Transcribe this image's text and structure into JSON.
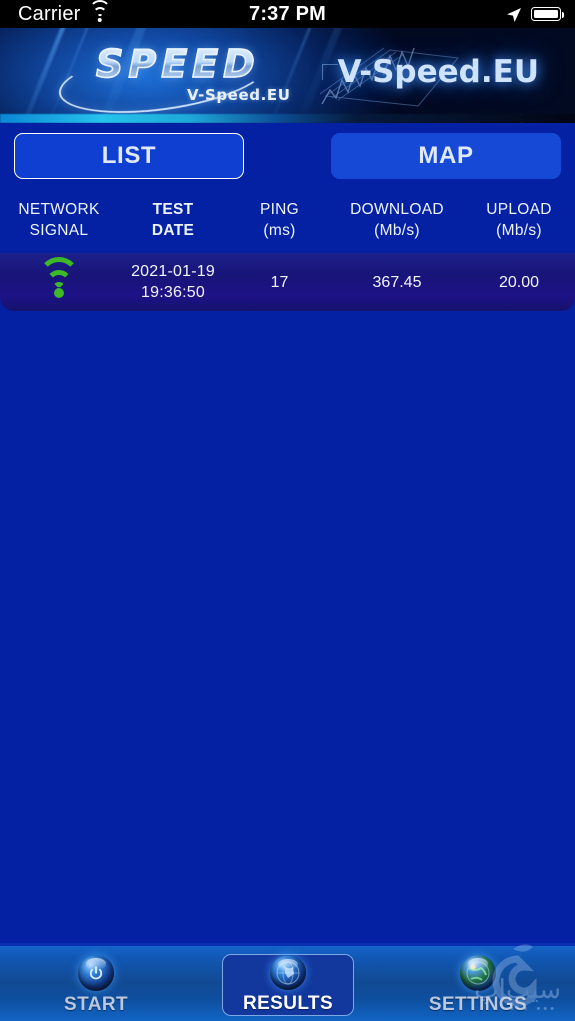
{
  "statusbar": {
    "carrier": "Carrier",
    "wifi_icon": "wifi-icon",
    "time": "7:37 PM",
    "location_icon": "location-arrow-icon",
    "battery_icon": "battery-full-icon"
  },
  "banner": {
    "logo_word": "SPEED",
    "logo_subtitle": "V-Speed.EU",
    "title": "V-Speed.EU",
    "map_art": "network-graph-art"
  },
  "segments": {
    "list_label": "LIST",
    "map_label": "MAP",
    "selected": "LIST"
  },
  "table": {
    "columns": [
      {
        "line1": "NETWORK",
        "line2": "SIGNAL",
        "bold": false
      },
      {
        "line1": "TEST",
        "line2": "DATE",
        "bold": true
      },
      {
        "line1": "PING",
        "line2": "(ms)",
        "bold": false
      },
      {
        "line1": "DOWNLOAD",
        "line2": "(Mb/s)",
        "bold": false
      },
      {
        "line1": "UPLOAD",
        "line2": "(Mb/s)",
        "bold": false
      }
    ],
    "rows": [
      {
        "signal_icon": "wifi-icon",
        "date": "2021-01-19",
        "time": "19:36:50",
        "ping": "17",
        "download": "367.45",
        "upload": "20.00"
      }
    ]
  },
  "tabbar": {
    "start_label": "START",
    "start_icon": "power-icon",
    "results_label": "RESULTS",
    "results_icon": "globe-icon",
    "settings_label": "SETTINGS",
    "settings_icon": "globe-gear-icon",
    "selected": "RESULTS"
  },
  "watermark": {
    "text": "سیب‌اپ",
    "dots": "••• •••"
  },
  "colors": {
    "page_background": "#0521A3",
    "row_background": "#181478",
    "segment_selected": "#0F3FD0",
    "segment_unselected": "#1649D6",
    "signal_green": "#3CB828",
    "tabbar_blue": "#114A93",
    "text_light": "#EEF4FF"
  }
}
